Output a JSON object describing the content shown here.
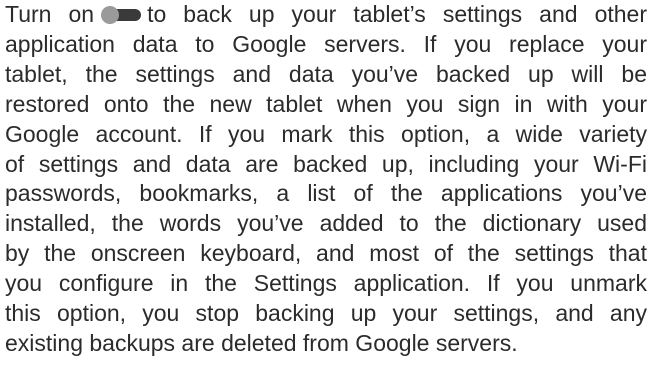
{
  "paragraph": {
    "line1_before_toggle": "Turn on",
    "line1_after_toggle": "to back up your tablet’s settings and other",
    "lines": [
      "application data to Google servers. If you replace your",
      "tablet, the settings and data you’ve backed up will be",
      "restored onto the new tablet when you sign in with your",
      "Google account. If you mark this option, a wide variety",
      "of settings and data are backed up, including your Wi-Fi",
      "passwords, bookmarks, a list of the applications you’ve",
      "installed, the words you’ve added to the dictionary used",
      "by the onscreen keyboard, and most of the settings that",
      "you configure in the Settings application. If you unmark",
      "this option, you stop backing up your settings, and any",
      "existing backups are deleted from Google servers."
    ]
  },
  "icons": {
    "toggle": "toggle-switch-icon"
  }
}
